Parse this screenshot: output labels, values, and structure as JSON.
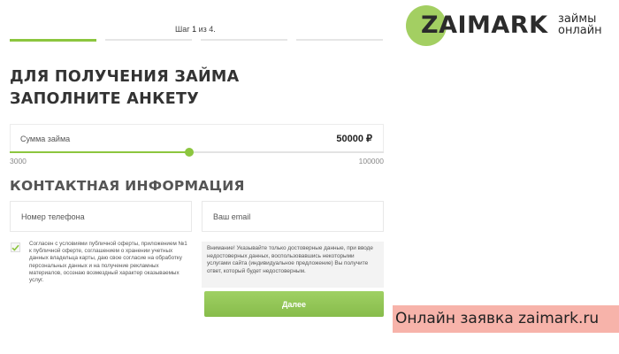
{
  "steps": {
    "label_prefix": "Шаг",
    "current": "1",
    "separator": "из",
    "total": "4.",
    "count": 4,
    "active_index": 0
  },
  "logo": {
    "word": "ZAIMARK",
    "sub_line1": "займы",
    "sub_line2": "онлайн",
    "circle_color": "#a3cf62"
  },
  "title": {
    "line1": "ДЛЯ ПОЛУЧЕНИЯ ЗАЙМА",
    "line2": "ЗАПОЛНИТЕ АНКЕТУ"
  },
  "amount": {
    "label": "Сумма займа",
    "value_text": "50000 ₽",
    "min": 3000,
    "max": 100000,
    "min_label": "3000",
    "max_label": "100000",
    "slider_fraction": 0.48,
    "accent": "#8cc63f"
  },
  "contact": {
    "title": "КОНТАКТНАЯ ИНФОРМАЦИЯ",
    "phone_placeholder": "Номер телефона",
    "email_placeholder": "Ваш email"
  },
  "consent": {
    "checked": true,
    "text": "Согласен с условиями публичной оферты, приложением №1 к публичной оферте, соглашением о хранении учетных данных владельца карты, даю свое согласие на обработку персональных данных и на получение рекламных материалов, осознаю возмездный характер оказываемых услуг."
  },
  "notice": {
    "text": "Внимание! Указывайте только достоверные данные, при вводе недостоверных данных, воспользовавшись некоторыми услугами сайта (индивидуальное предложение) Вы получите ответ, который будет недостоверным."
  },
  "submit": {
    "label": "Далее"
  },
  "banner": {
    "text": "Онлайн заявка zaimark.ru"
  }
}
